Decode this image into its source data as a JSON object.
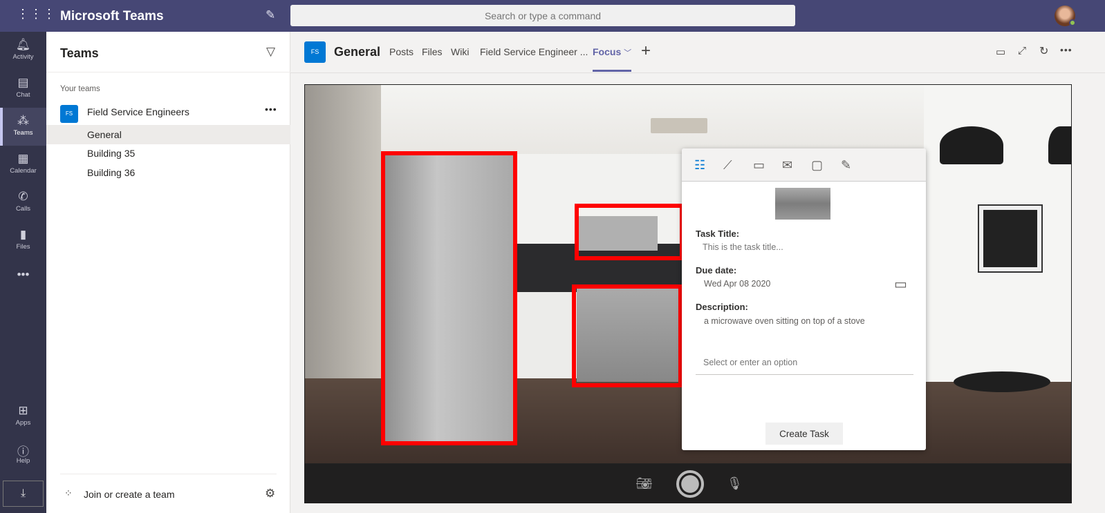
{
  "app": {
    "title": "Microsoft Teams",
    "search_placeholder": "Search or type a command"
  },
  "rail": [
    {
      "label": "Activity",
      "icon": "bell-icon"
    },
    {
      "label": "Chat",
      "icon": "chat-icon"
    },
    {
      "label": "Teams",
      "icon": "teams-icon",
      "active": true
    },
    {
      "label": "Calendar",
      "icon": "calendar-icon"
    },
    {
      "label": "Calls",
      "icon": "phone-icon"
    },
    {
      "label": "Files",
      "icon": "file-icon"
    },
    {
      "label": "Apps",
      "icon": "apps-icon"
    },
    {
      "label": "Help",
      "icon": "help-icon"
    }
  ],
  "panel": {
    "title": "Teams",
    "section": "Your teams",
    "team": {
      "initials": "FS",
      "name": "Field Service Engineers"
    },
    "channels": [
      "General",
      "Building 35",
      "Building 36"
    ],
    "join": "Join or create a team"
  },
  "channel": {
    "initials": "FS",
    "name": "General",
    "tabs": [
      "Posts",
      "Files",
      "Wiki",
      "Field Service Engineer ...",
      "Focus"
    ],
    "active_tab": "Focus"
  },
  "task": {
    "title_label": "Task Title:",
    "title_placeholder": "This is the task title...",
    "due_label": "Due date:",
    "due_value": "Wed Apr 08 2020",
    "desc_label": "Description:",
    "desc_value": "a microwave oven sitting on top of a stove",
    "option_placeholder": "Select or enter an option",
    "create_button": "Create Task"
  },
  "colors": {
    "topbar": "#464775",
    "rail": "#33344a",
    "accent": "#6264a7",
    "badge": "#0078d4",
    "detection_box": "#ff0000"
  }
}
